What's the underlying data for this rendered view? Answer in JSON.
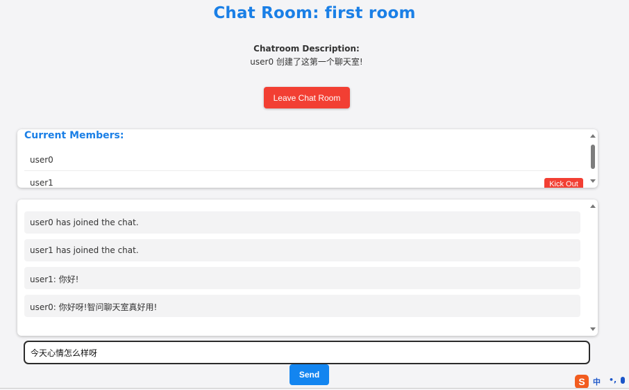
{
  "room": {
    "title": "Chat Room: first room",
    "description_label": "Chatroom Description:",
    "description": "user0 创建了这第一个聊天室!",
    "leave_label": "Leave Chat Room"
  },
  "members": {
    "title": "Current Members:",
    "list": [
      {
        "name": "user0"
      },
      {
        "name": "user1",
        "action": "Kick Out"
      }
    ]
  },
  "messages": [
    "user0 has joined the chat.",
    "user1 has joined the chat.",
    "user1: 你好!",
    "user0: 你好呀!智问聊天室真好用!"
  ],
  "composer": {
    "value": "今天心情怎么样呀",
    "send_label": "Send"
  },
  "ime": {
    "logo": "S",
    "mode": "中",
    "punct": "•,"
  },
  "colors": {
    "accent": "#1a7fe6",
    "danger": "#f23f33",
    "send": "#1385f0"
  }
}
